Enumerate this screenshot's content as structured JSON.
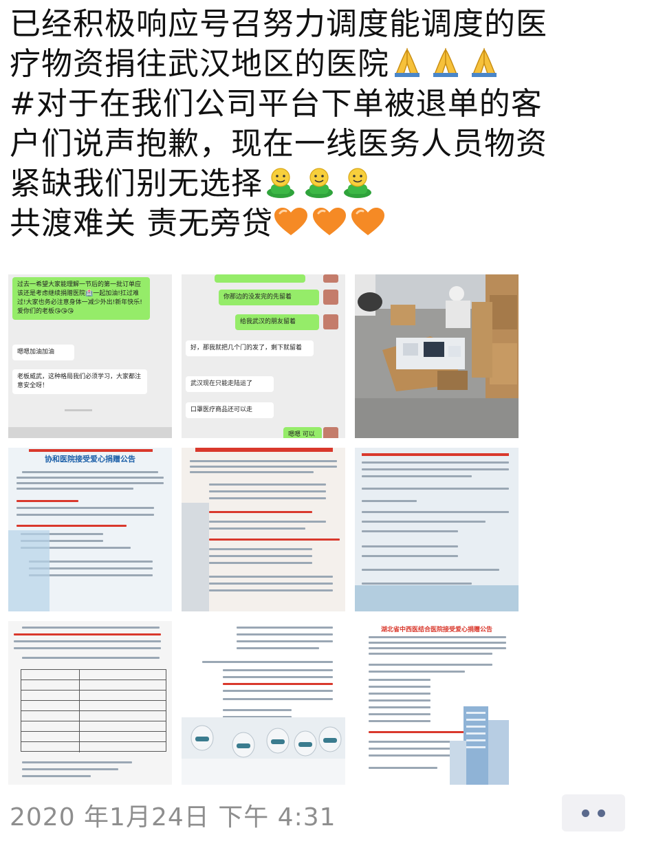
{
  "post": {
    "lines": [
      "已经积极响应号召努力调度能调度的医",
      "疗物资捐往武汉地区的医院",
      "#对于在我们公司平台下单被退单的客",
      "户们说声抱歉，现在一线医务人员物资",
      "紧缺我们别无选择",
      "共渡难关 责无旁贷"
    ],
    "line_emojis": [
      "",
      "folded-hands-icon",
      "",
      "",
      "green-person-icon",
      "orange-heart-icon"
    ],
    "emoji_repeat": 3,
    "colors": {
      "text": "#111111",
      "meta": "#8e8e8e",
      "bubble_green": "#95ec69",
      "notice_title": "#1b5fa8",
      "notice_red": "#d9382c"
    }
  },
  "images": {
    "chat1": {
      "bubble_green": "过去一希望大家能理解一节后的第一批订单应该还是考虑继续捐赠医院🏥一起加油!扛过难过!大家也务必注意身体一减少外出!新年快乐!爱你们的老板😘😘😘",
      "reply1": "嗯嗯加油加油",
      "reply2": "老板威武，这种格局我们必须学习，大家都注意安全呀！"
    },
    "chat2": {
      "m1": "你那边的没发完的先留着",
      "m2": "给我武汉的朋友留着",
      "r1": "好，那我就把几个门的发了，剩下就留着",
      "r2": "武汉现在只能走陆运了",
      "r3": "口罩医疗商品还可以走",
      "r4": "嗯嗯 可以"
    },
    "notice1_title": "协和医院接受爱心捐赠公告",
    "notice6_title": "湖北省中西医结合医院接受爱心捐赠公告"
  },
  "meta": {
    "timestamp": "2020 年1月24日 下午 4:31",
    "more_icon": "more-dots-icon"
  }
}
